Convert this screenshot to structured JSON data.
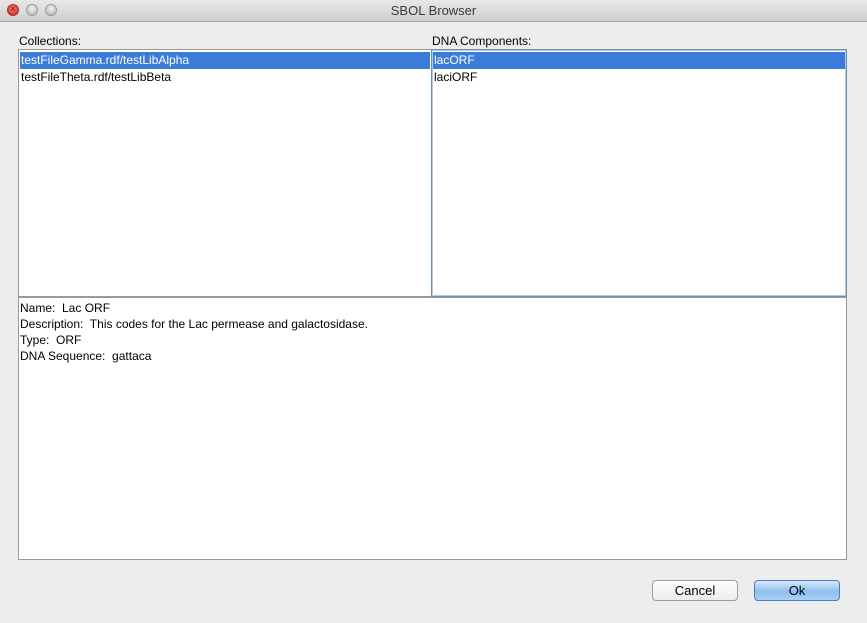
{
  "window": {
    "title": "SBOL Browser",
    "controls": {
      "close": "close-icon",
      "minimize": "minimize-icon",
      "zoom": "zoom-icon"
    }
  },
  "collections": {
    "label": "Collections:",
    "items": [
      {
        "label": "testFileGamma.rdf/testLibAlpha",
        "selected": true
      },
      {
        "label": "testFileTheta.rdf/testLibBeta",
        "selected": false
      }
    ]
  },
  "dna_components": {
    "label": "DNA Components:",
    "items": [
      {
        "label": "lacORF",
        "selected": true
      },
      {
        "label": "laciORF",
        "selected": false
      }
    ]
  },
  "details": {
    "lines": [
      "Name:  Lac ORF",
      "Description:  This codes for the Lac permease and galactosidase.",
      "Type:  ORF",
      "DNA Sequence:  gattaca"
    ]
  },
  "buttons": {
    "cancel": "Cancel",
    "ok": "Ok"
  },
  "colors": {
    "selection": "#3b7bd9",
    "default_button": "#8fbfef",
    "close_button": "#d9362c"
  }
}
